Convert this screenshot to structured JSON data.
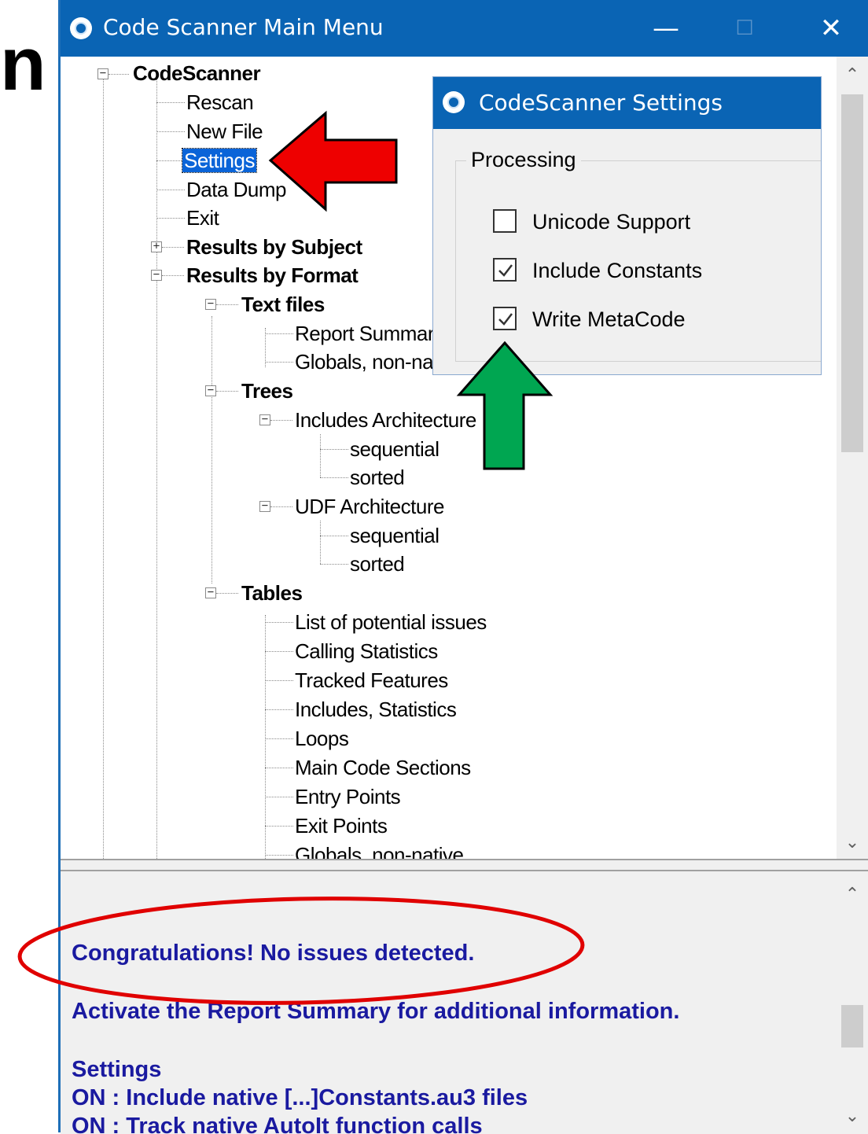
{
  "edge_char": "n",
  "window": {
    "title": "Code Scanner Main Menu",
    "minimize_glyph": "—",
    "maximize_glyph": "☐",
    "close_glyph": "✕"
  },
  "tree": {
    "root": "CodeScanner",
    "root_children": [
      "Rescan",
      "New File",
      "Settings",
      "Data Dump",
      "Exit"
    ],
    "selected": "Settings",
    "results_by_subject": "Results by Subject",
    "results_by_format": "Results by Format",
    "text_files": {
      "label": "Text files",
      "items": [
        "Report Summary",
        "Globals, non-native"
      ]
    },
    "trees": {
      "label": "Trees",
      "includes_arch": {
        "label": "Includes Architecture",
        "items": [
          "sequential",
          "sorted"
        ]
      },
      "udf_arch": {
        "label": "UDF Architecture",
        "items": [
          "sequential",
          "sorted"
        ]
      }
    },
    "tables": {
      "label": "Tables",
      "items": [
        "List of potential issues",
        "Calling Statistics",
        "Tracked Features",
        "Includes, Statistics",
        "Loops",
        "Main Code Sections",
        "Entry Points",
        "Exit Points",
        "Globals, non-native"
      ]
    }
  },
  "messages": {
    "congrats": "Congratulations! No issues detected.",
    "activate": "Activate the Report Summary for additional information.",
    "settings_heading": "Settings",
    "line1": "ON : Include native [...]Constants.au3 files",
    "line2": "ON : Track native AutoIt function calls"
  },
  "settings_dialog": {
    "title": "CodeScanner Settings",
    "group": "Processing",
    "options": [
      {
        "label": "Unicode Support",
        "checked": false
      },
      {
        "label": "Include Constants",
        "checked": true
      },
      {
        "label": "Write MetaCode",
        "checked": true
      }
    ]
  },
  "colors": {
    "titlebar": "#0a64b4",
    "selection": "#0a64d8",
    "message_text": "#1a1aa0",
    "red_arrow": "#ee0000",
    "green_arrow": "#00a651",
    "ellipse": "#e00000"
  }
}
